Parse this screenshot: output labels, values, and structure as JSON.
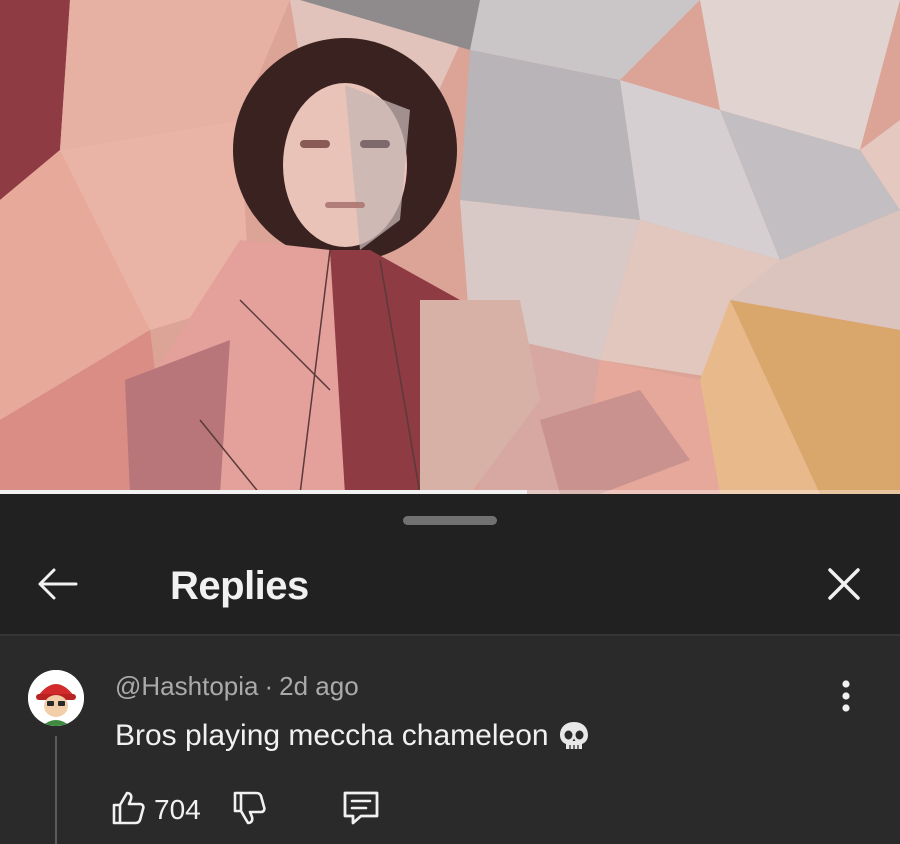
{
  "player": {
    "progress_fraction": 0.585
  },
  "sheet": {
    "title": "Replies",
    "back_icon": "arrow-left-icon",
    "close_icon": "close-icon"
  },
  "comment": {
    "author": "@Hashtopia",
    "separator": "·",
    "age": "2d ago",
    "text": "Bros playing meccha chameleon",
    "emoji": "skull-emoji",
    "likes": "704"
  },
  "colors": {
    "sheet_bg": "#212121",
    "comment_bg": "#2a2a2a",
    "text_primary": "#f1f1f1",
    "text_secondary": "#aaaaaa",
    "avatar_cap": "#d12b2b"
  }
}
